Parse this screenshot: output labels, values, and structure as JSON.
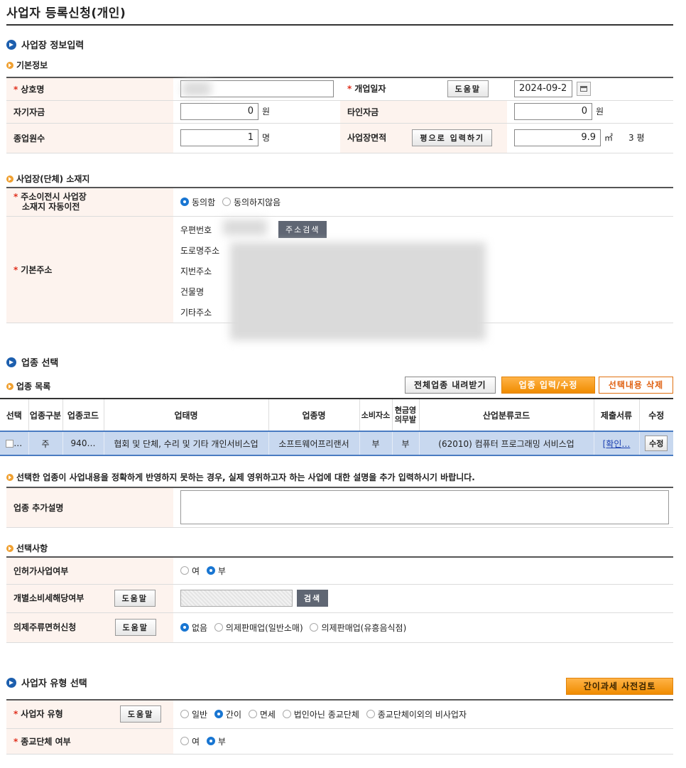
{
  "page_title": "사업자 등록신청(개인)",
  "biz_info": {
    "section_title": "사업장 정보입력",
    "basic_title": "기본정보",
    "trade_name_label": "상호명",
    "open_date_label": "개업일자",
    "open_date_help": "도움말",
    "open_date_value": "2024-09-2",
    "own_capital_label": "자기자금",
    "own_capital_value": "0",
    "other_capital_label": "타인자금",
    "other_capital_value": "0",
    "won_unit": "원",
    "employees_label": "종업원수",
    "employees_value": "1",
    "person_unit": "명",
    "area_label": "사업장면적",
    "area_pyeong_btn": "평으로 입력하기",
    "area_value": "9.9",
    "area_unit": "㎡",
    "area_pyeong": "3 평"
  },
  "address": {
    "title": "사업장(단체) 소재지",
    "auto_move_label_1": "주소이전시 사업장",
    "auto_move_label_2": "소재지 자동이전",
    "agree": "동의함",
    "disagree": "동의하지않음",
    "base_label": "기본주소",
    "postal": "우편번호",
    "search_btn": "주소검색",
    "road": "도로명주소",
    "lot": "지번주소",
    "building": "건물명",
    "etc": "기타주소"
  },
  "industry": {
    "section_title": "업종 선택",
    "list_title": "업종 목록",
    "download_btn": "전체업종 내려받기",
    "edit_btn": "업종 입력/수정",
    "delete_btn": "선택내용 삭제",
    "headers": [
      "선택",
      "업종구분",
      "업종코드",
      "업태명",
      "업종명",
      "소비자소",
      "현금영\n의무발",
      "산업분류코드",
      "제출서류",
      "수정"
    ],
    "row": {
      "type": "주",
      "code": "940…",
      "biz_type": "협회 및 단체, 수리 및 기타 개인서비스업",
      "item": "소프트웨어프리랜서",
      "consumer": "부",
      "cash": "부",
      "class_code": "(62010) 컴퓨터 프로그래밍 서비스업",
      "docs": "[확인…",
      "edit": "수정"
    },
    "notice": "선택한 업종이 사업내용을 정확하게 반영하지 못하는 경우, 실제 영위하고자 하는 사업에 대한 설명을 추가 입력하시기 바랍니다.",
    "extra_label": "업종 추가설명"
  },
  "options": {
    "title": "선택사항",
    "permit_label": "인허가사업여부",
    "yes": "여",
    "no": "부",
    "excise_label": "개별소비세해당여부",
    "help": "도움말",
    "search": "검색",
    "liquor_label": "의제주류면허신청",
    "none": "없음",
    "liquor_opt1": "의제판매업(일반소매)",
    "liquor_opt2": "의제판매업(유흥음식점)"
  },
  "biz_type": {
    "section_title": "사업자 유형 선택",
    "precheck_btn": "간이과세 사전검토",
    "type_label": "사업자 유형",
    "help": "도움말",
    "general": "일반",
    "simple": "간이",
    "exempt": "면세",
    "religious_nonprofit": "법인아닌 종교단체",
    "other_nonbiz": "종교단체이외의 비사업자",
    "religious_label": "종교단체 여부",
    "yes": "여",
    "no": "부"
  }
}
